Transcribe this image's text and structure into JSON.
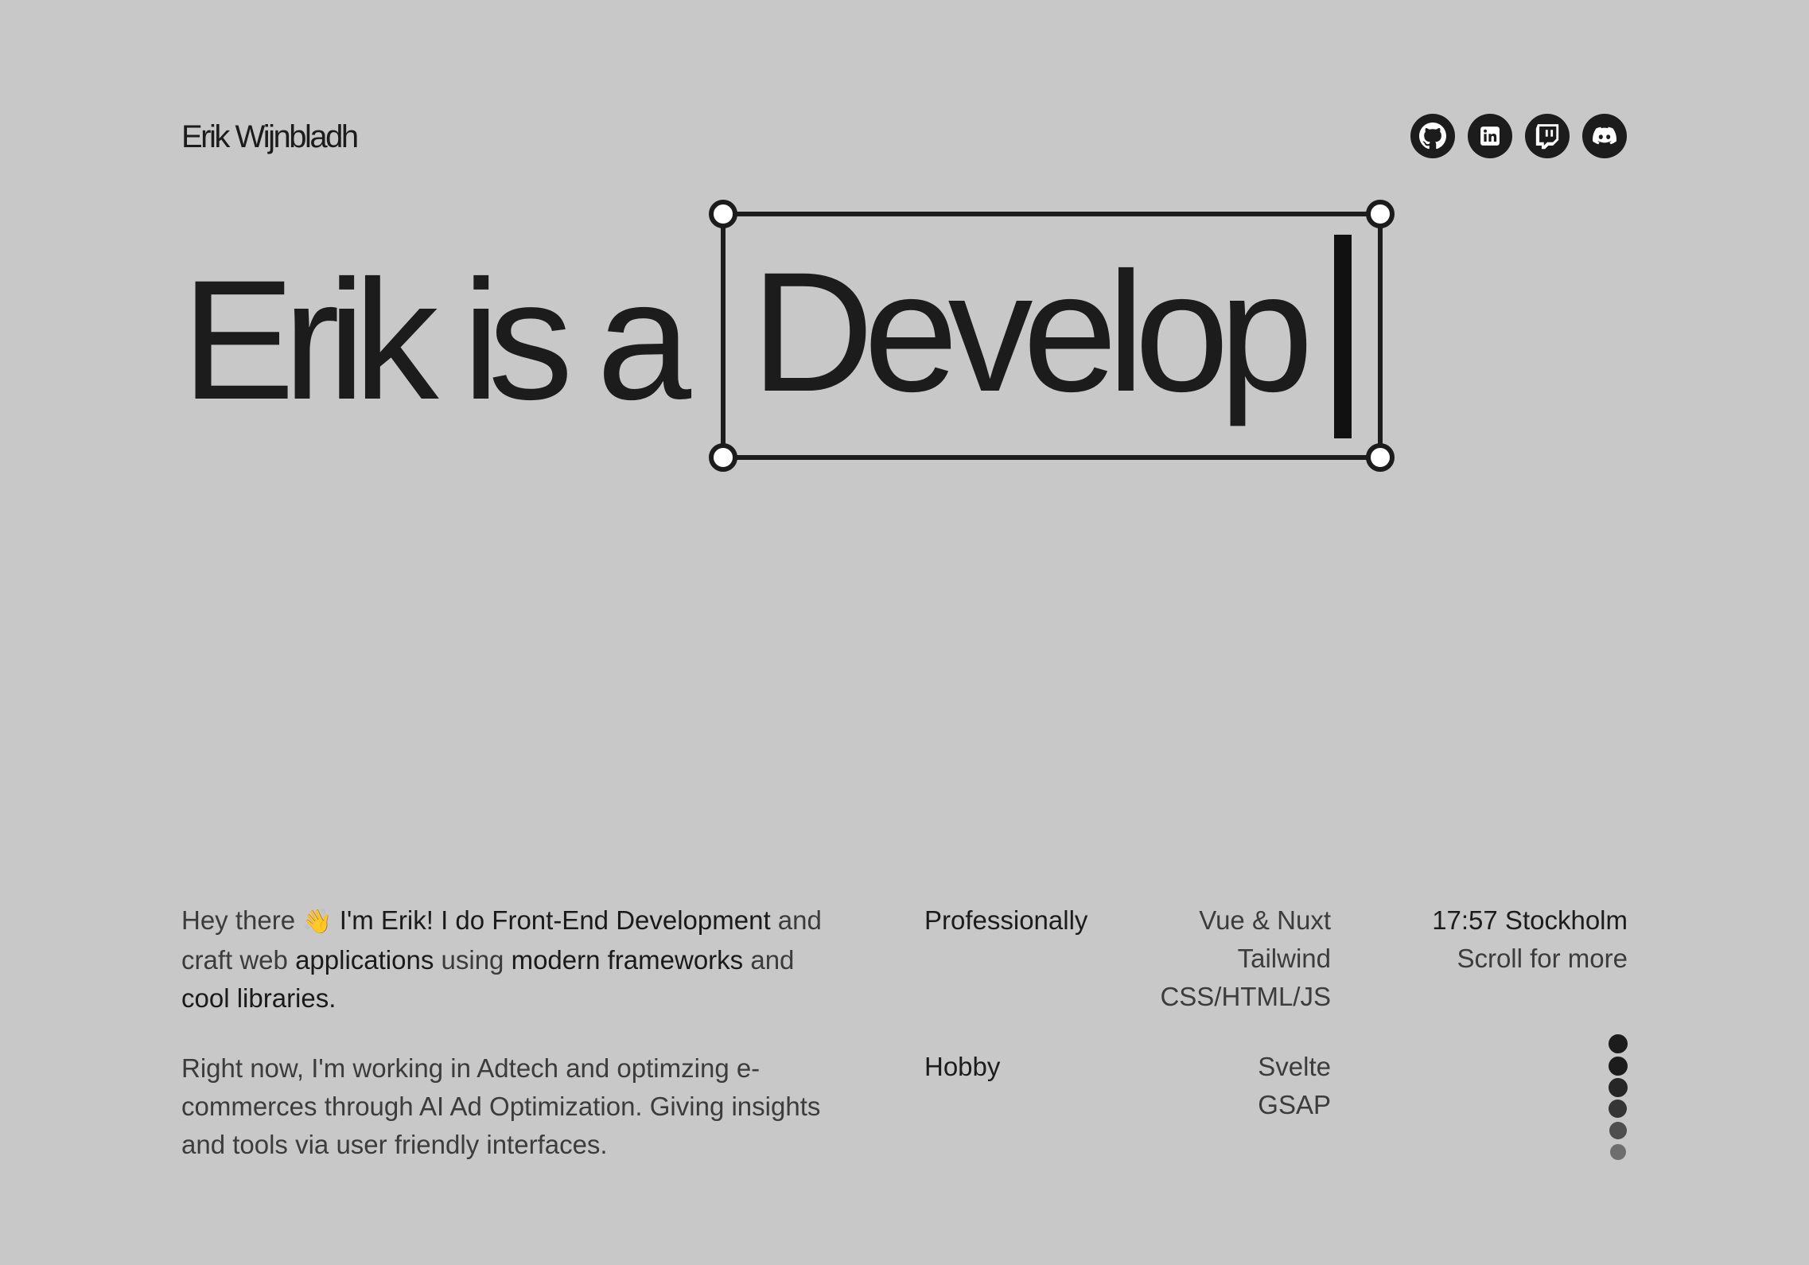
{
  "header": {
    "brand": "Erik Wijnbladh",
    "socials": [
      {
        "icon": "github-icon",
        "label": "GitHub"
      },
      {
        "icon": "linkedin-icon",
        "label": "LinkedIn"
      },
      {
        "icon": "twitch-icon",
        "label": "Twitch"
      },
      {
        "icon": "discord-icon",
        "label": "Discord"
      }
    ]
  },
  "hero": {
    "prefix": "Erik is a",
    "typed_word": "Develop"
  },
  "intro": {
    "p1": {
      "a": "Hey there ",
      "wave": "👋",
      "b": " I'm Erik! I do ",
      "c": "Front-End Development",
      "d": " and craft web ",
      "e": "applications",
      "f": " using ",
      "g": "modern frameworks",
      "h": " and ",
      "i": "cool libraries",
      "j": "."
    },
    "p2": "Right now, I'm working in Adtech and optimzing e-commerces through AI Ad Optimization. Giving insights and tools via user friendly interfaces."
  },
  "skills": {
    "professional": {
      "label": "Professionally",
      "items": [
        "Vue & Nuxt",
        "Tailwind",
        "CSS/HTML/JS"
      ]
    },
    "hobby": {
      "label": "Hobby",
      "items": [
        "Svelte",
        "GSAP"
      ]
    }
  },
  "status": {
    "clock": "17:57 Stockholm",
    "scroll_hint": "Scroll for more"
  },
  "colors": {
    "background": "#c8c8c8",
    "ink": "#1c1c1c",
    "muted": "#3c3c3c"
  }
}
